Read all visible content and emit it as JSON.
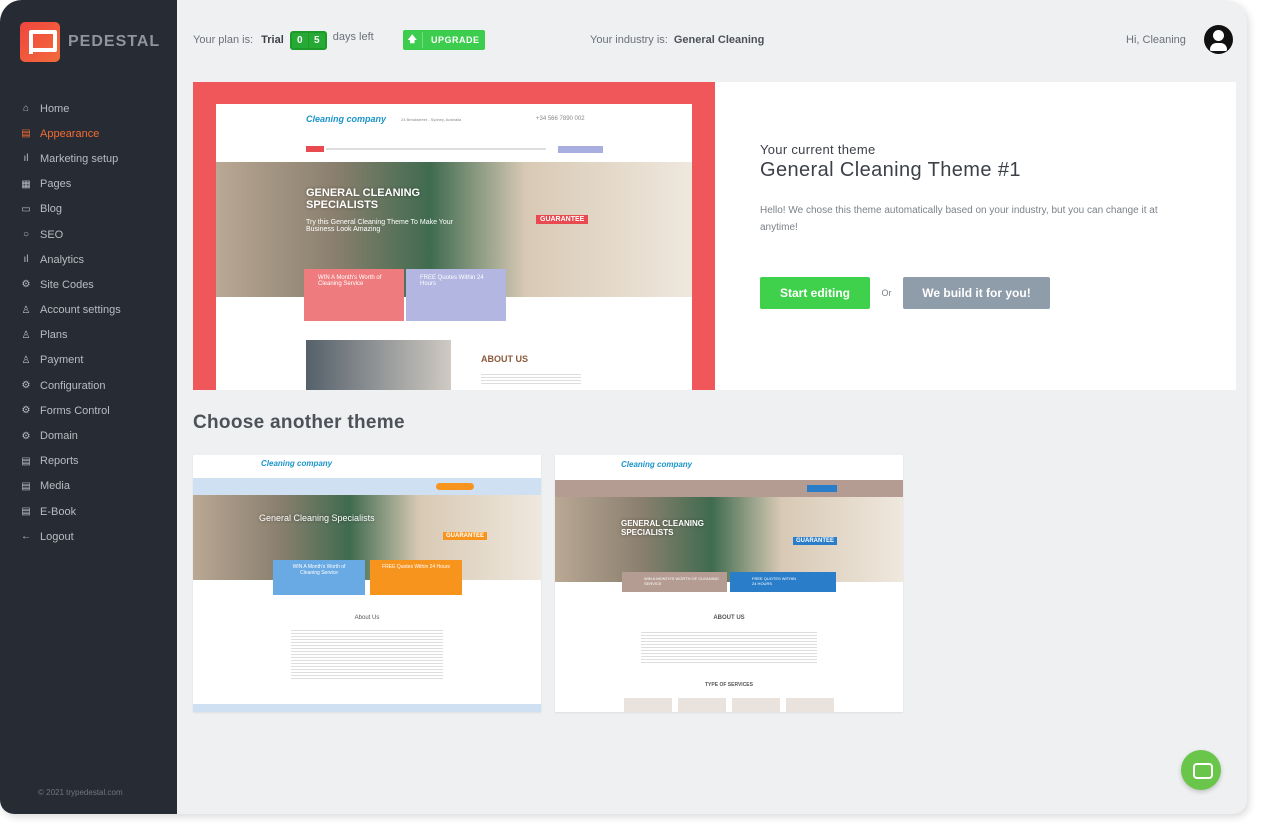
{
  "brand": {
    "name": "PEDESTAL",
    "copyright": "© 2021 trypedestal.com"
  },
  "sidebar": {
    "items": [
      {
        "label": "Home",
        "icon": "home-icon",
        "glyph": "⌂"
      },
      {
        "label": "Appearance",
        "icon": "layout-icon",
        "glyph": "▤",
        "active": true
      },
      {
        "label": "Marketing setup",
        "icon": "bar-chart-icon",
        "glyph": "ıl"
      },
      {
        "label": "Pages",
        "icon": "pages-icon",
        "glyph": "▦"
      },
      {
        "label": "Blog",
        "icon": "comment-icon",
        "glyph": "▭"
      },
      {
        "label": "SEO",
        "icon": "search-icon",
        "glyph": "○"
      },
      {
        "label": "Analytics",
        "icon": "bar-chart-icon",
        "glyph": "ıl"
      },
      {
        "label": "Site Codes",
        "icon": "gear-icon",
        "glyph": "⚙"
      },
      {
        "label": "Account settings",
        "icon": "user-icon",
        "glyph": "♙"
      },
      {
        "label": "Plans",
        "icon": "user-icon",
        "glyph": "♙"
      },
      {
        "label": "Payment",
        "icon": "user-icon",
        "glyph": "♙"
      },
      {
        "label": "Configuration",
        "icon": "gear-icon",
        "glyph": "⚙"
      },
      {
        "label": "Forms Control",
        "icon": "gear-icon",
        "glyph": "⚙"
      },
      {
        "label": "Domain",
        "icon": "gear-icon",
        "glyph": "⚙"
      },
      {
        "label": "Reports",
        "icon": "report-icon",
        "glyph": "▤"
      },
      {
        "label": "Media",
        "icon": "media-icon",
        "glyph": "▤"
      },
      {
        "label": "E-Book",
        "icon": "book-icon",
        "glyph": "▤"
      },
      {
        "label": "Logout",
        "icon": "arrow-left-icon",
        "glyph": "←"
      }
    ]
  },
  "topbar": {
    "plan_label": "Your plan is:",
    "plan": "Trial",
    "days": [
      "0",
      "5"
    ],
    "days_suffix": "days left",
    "upgrade": "UPGRADE",
    "industry_label": "Your industry is:",
    "industry": "General Cleaning",
    "greeting": "Hi, Cleaning"
  },
  "current": {
    "label": "Your current theme",
    "title": "General Cleaning Theme #1",
    "desc": "Hello! We chose this theme automatically based on your industry, but you can change it at anytime!",
    "start": "Start editing",
    "or": "Or",
    "build": "We build it for you!"
  },
  "choose_title": "Choose another theme",
  "previews": {
    "logo": "Cleaning company",
    "main": {
      "address": "24 Breakstreet - Sydney, Australia",
      "phone": "+34 566 7890 002",
      "hero": "GENERAL CLEANING SPECIALISTS",
      "sub": "Try this General Cleaning Theme To Make Your Business Look Amazing",
      "badge": "GUARANTEE",
      "box1": "WIN A Month's Worth of Cleaning Service",
      "box2": "FREE Quotes Within 24 Hours",
      "about": "ABOUT US"
    },
    "theme2": {
      "hero": "General Cleaning Specialists",
      "badge": "GUARANTEE",
      "box1": "WIN A Month's Worth of Cleaning Service",
      "box2": "FREE Quotes Within 24 Hours",
      "about": "About Us"
    },
    "theme3": {
      "hero": "GENERAL CLEANING SPECIALISTS",
      "badge": "GUARANTEE",
      "box1": "WIN A MONTH'S WORTH OF CLEANING SERVICE",
      "box2": "FREE QUOTES WITHIN 24 HOURS",
      "about": "ABOUT US",
      "services": "TYPE OF SERVICES"
    }
  },
  "colors": {
    "accent": "#f36b33",
    "green": "#3fd14c",
    "theme_red": "#f0575a",
    "sidebar": "#272c34"
  }
}
